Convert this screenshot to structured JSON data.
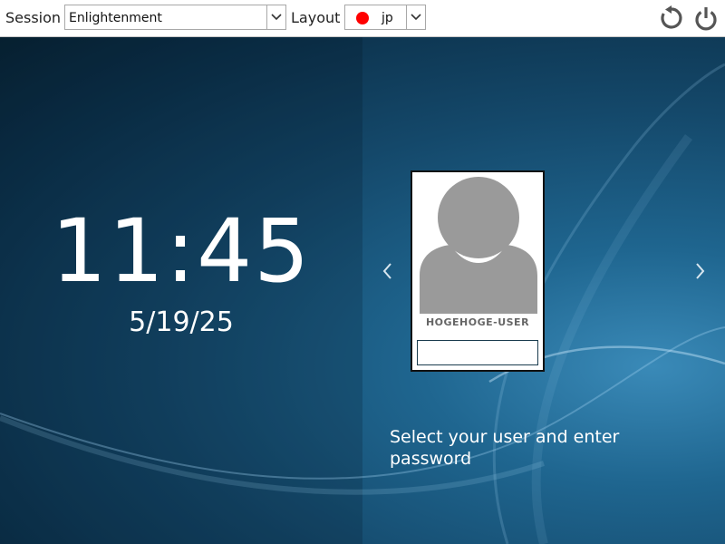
{
  "topbar": {
    "session_label": "Session",
    "session_value": "Enlightenment",
    "layout_label": "Layout",
    "layout_value": "jp",
    "layout_flag_color": "#ff0000",
    "icons": {
      "reboot": "reboot-icon",
      "shutdown": "power-icon",
      "dropdown": "chevron-down-icon"
    }
  },
  "clock": {
    "time": "11:45",
    "date": "5/19/25"
  },
  "login": {
    "username": "HOGEHOGE-USER",
    "password_value": "",
    "hint": "Select your user and enter password"
  },
  "colors": {
    "accent": "#1f6690",
    "avatar_gray": "#9a9a9a",
    "text_light": "#ffffff"
  }
}
